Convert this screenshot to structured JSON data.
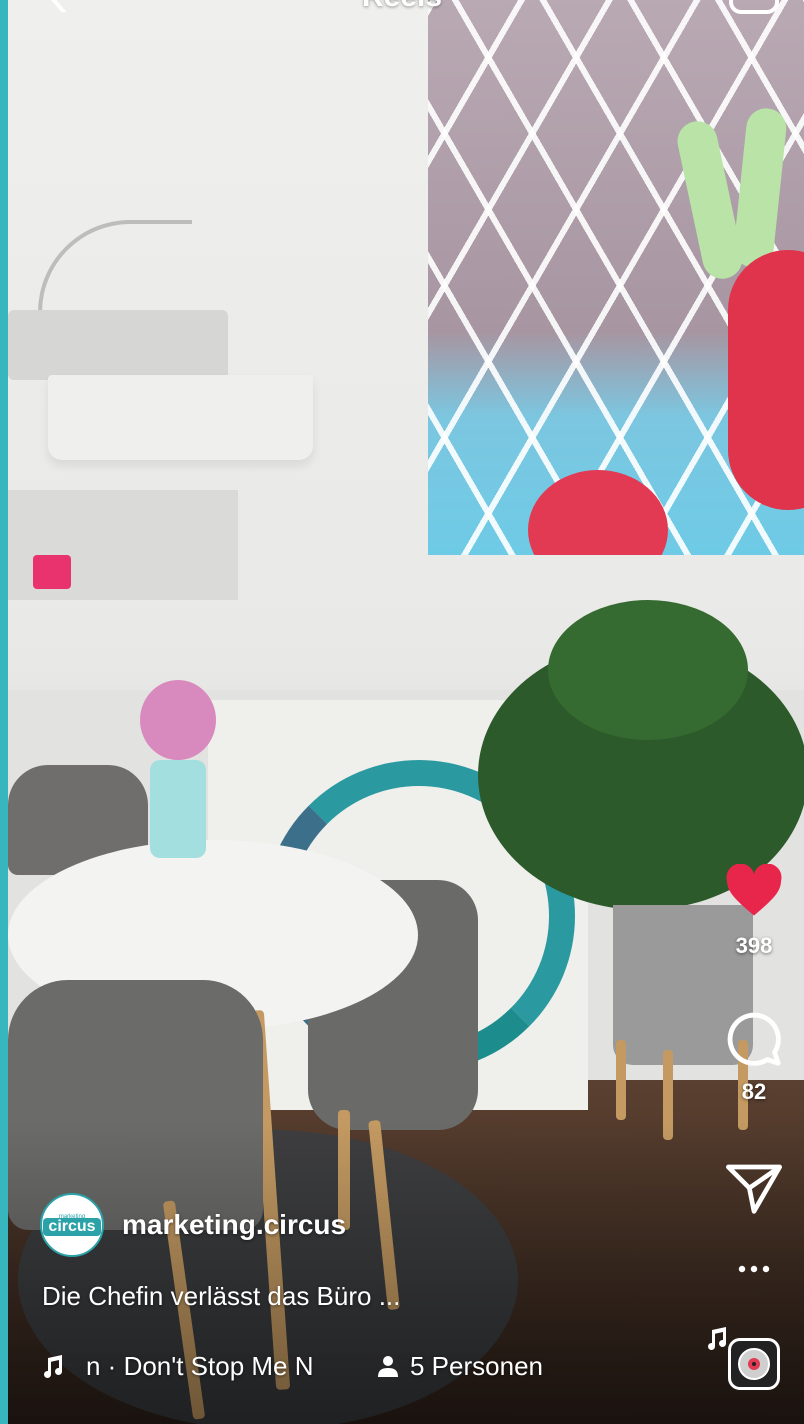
{
  "header": {
    "title": "Reels"
  },
  "actions": {
    "likes_count": "398",
    "comments_count": "82"
  },
  "post": {
    "author": "marketing.circus",
    "avatar_text": "circus",
    "avatar_small": "marketing",
    "caption": "Die Chefin verlässt das Büro ...",
    "audio": "n · Don't Stop Me N",
    "people": "5 Personen"
  },
  "colors": {
    "like": "#e8254a",
    "accent_edge": "#37b6bd"
  },
  "icons": [
    "back-icon",
    "camera-icon",
    "heart-icon",
    "comment-icon",
    "share-icon",
    "more-icon",
    "music-note-icon",
    "person-icon",
    "audio-thumbnail"
  ]
}
